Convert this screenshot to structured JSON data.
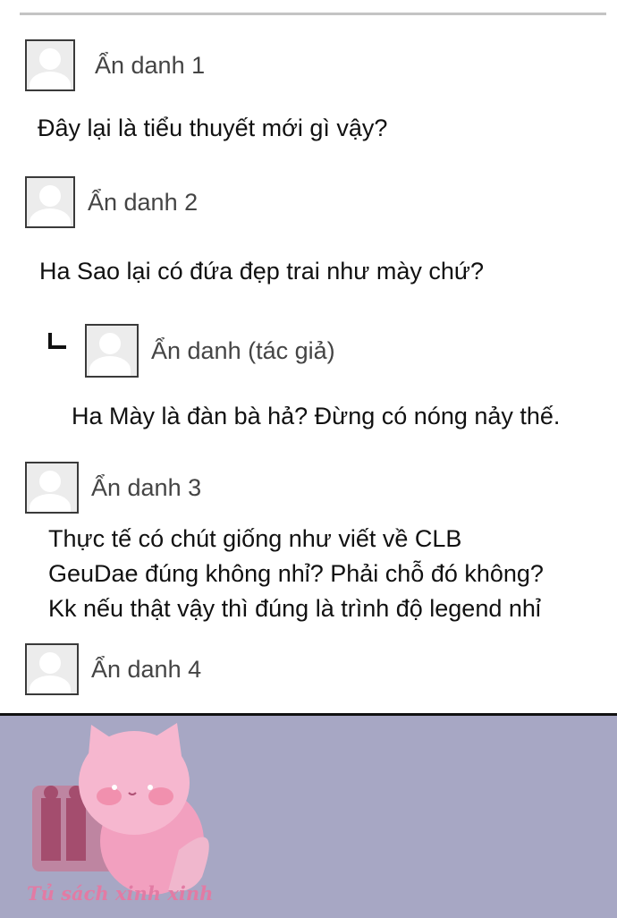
{
  "comments": [
    {
      "author": "Ẩn danh 1",
      "text": "Đây lại là tiểu thuyết mới gì vậy?"
    },
    {
      "author": "Ẩn danh 2",
      "text": "Ha Sao lại có đứa đẹp trai như mày chứ?"
    },
    {
      "author": "Ẩn danh (tác giả)",
      "text": "Ha Mày là đàn bà hả? Đừng có nóng nảy thế.",
      "is_reply": true
    },
    {
      "author": "Ẩn danh 3",
      "text": "Thực tế có chút giống như viết về CLB\nGeuDae đúng không nhỉ? Phải chỗ đó không?\nKk nếu thật vậy thì đúng là trình độ legend nhỉ"
    },
    {
      "author": "Ẩn danh 4",
      "text": ""
    }
  ],
  "watermark": {
    "text": "Tủ sách xinh xinh",
    "icon": "cat-mascot-icon"
  },
  "colors": {
    "panel": "#a7a7c4",
    "accent": "#e27ba4"
  }
}
